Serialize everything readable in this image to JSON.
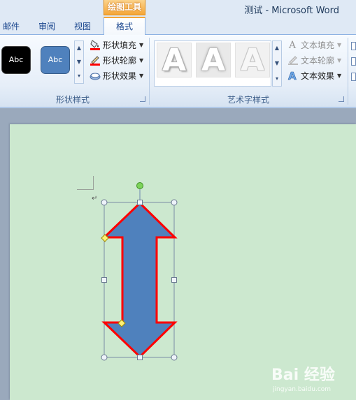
{
  "window": {
    "title": "测试 - Microsoft Word",
    "context_tab_group": "绘图工具"
  },
  "tabs": [
    {
      "label": "邮件",
      "active": false
    },
    {
      "label": "审阅",
      "active": false
    },
    {
      "label": "视图",
      "active": false
    },
    {
      "label": "格式",
      "active": true
    }
  ],
  "ribbon": {
    "shape_styles": {
      "group_label": "形状样式",
      "thumbnails": [
        {
          "label": "Abc",
          "fill": "#000000",
          "text_color": "#ffffff"
        },
        {
          "label": "Abc",
          "fill": "#4f81bd",
          "text_color": "#ffffff"
        }
      ],
      "commands": [
        {
          "label": "形状填充",
          "icon": "paint-bucket-icon",
          "accent": "#ff0000"
        },
        {
          "label": "形状轮廓",
          "icon": "pen-outline-icon",
          "accent": "#ff0000"
        },
        {
          "label": "形状效果",
          "icon": "shape-effects-icon"
        }
      ]
    },
    "wordart_styles": {
      "group_label": "艺术字样式",
      "gallery": [
        "A",
        "A",
        "A"
      ],
      "commands": [
        {
          "label": "文本填充",
          "icon": "text-fill-icon",
          "enabled": false
        },
        {
          "label": "文本轮廓",
          "icon": "text-outline-icon",
          "enabled": false
        },
        {
          "label": "文本效果",
          "icon": "text-effects-icon",
          "enabled": true
        }
      ]
    }
  },
  "document": {
    "page_color": "#cce8cf",
    "shape": {
      "type": "up-down-arrow",
      "fill": "#4f81bd",
      "outline": "#ff0000",
      "selected": true
    }
  },
  "watermark": {
    "logo": "Bai  经验",
    "url": "jingyan.baidu.com"
  }
}
